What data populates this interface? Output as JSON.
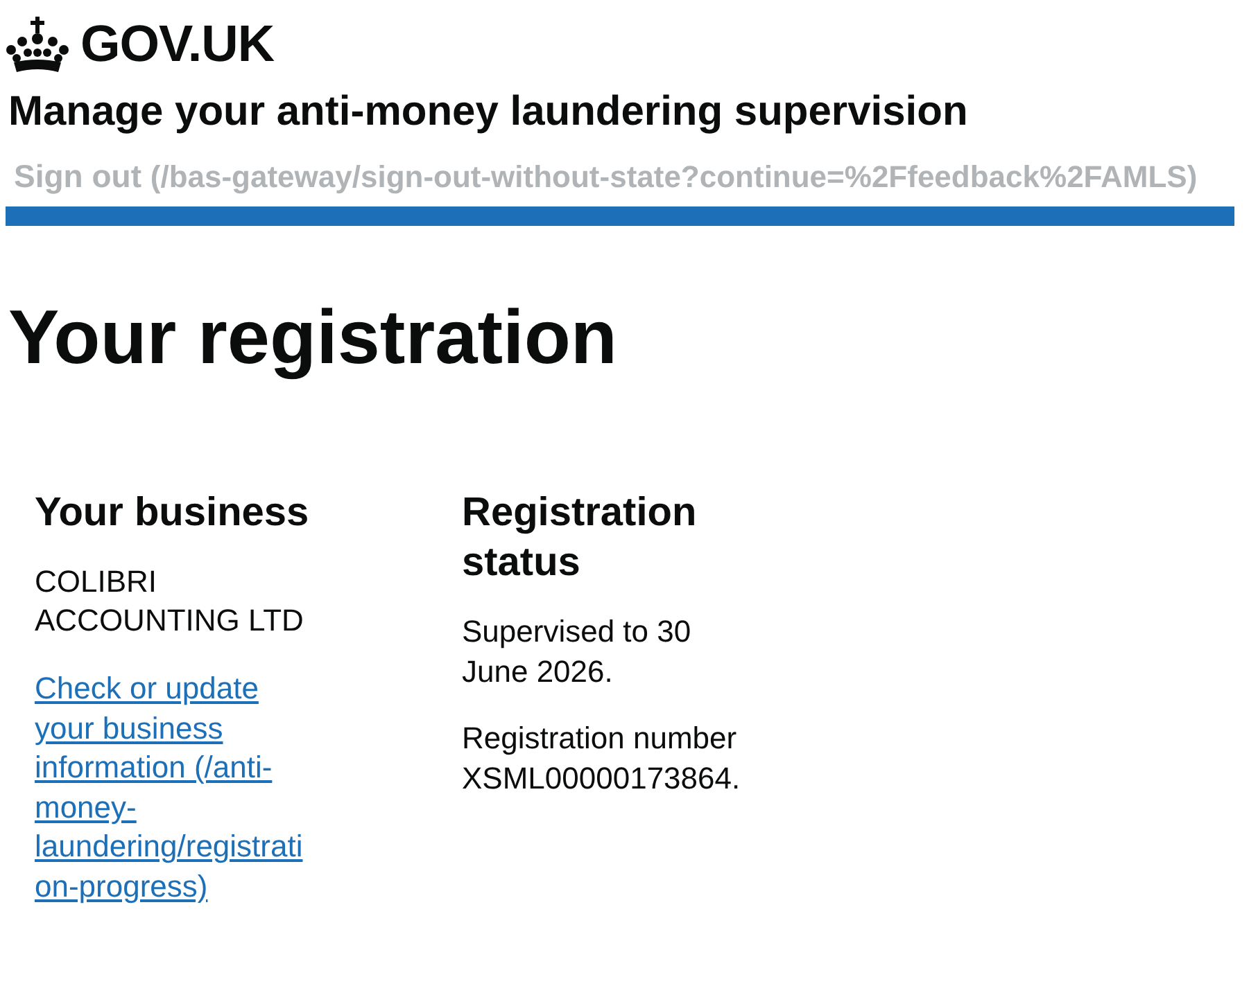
{
  "header": {
    "logo_text": "GOV.UK",
    "service_name": "Manage your anti-money laundering supervision",
    "sign_out": {
      "label": "Sign out",
      "url": "(/bas-gateway/sign-out-without-state?continue=%2Ffeedback%2FAMLS)"
    }
  },
  "page_title": "Your registration",
  "sections": [
    {
      "heading": "Your business",
      "paragraphs": [
        {
          "kind": "text",
          "text": "COLIBRI ACCOUNTING LTD"
        },
        {
          "kind": "link",
          "text": "Check or update your business information (/anti-money-laundering/registration-progress)"
        }
      ]
    },
    {
      "heading": "Registration status",
      "paragraphs": [
        {
          "kind": "text",
          "text": "Supervised to 30 June 2026."
        },
        {
          "kind": "text",
          "text": "Registration number XSML00000173864."
        }
      ]
    }
  ]
}
